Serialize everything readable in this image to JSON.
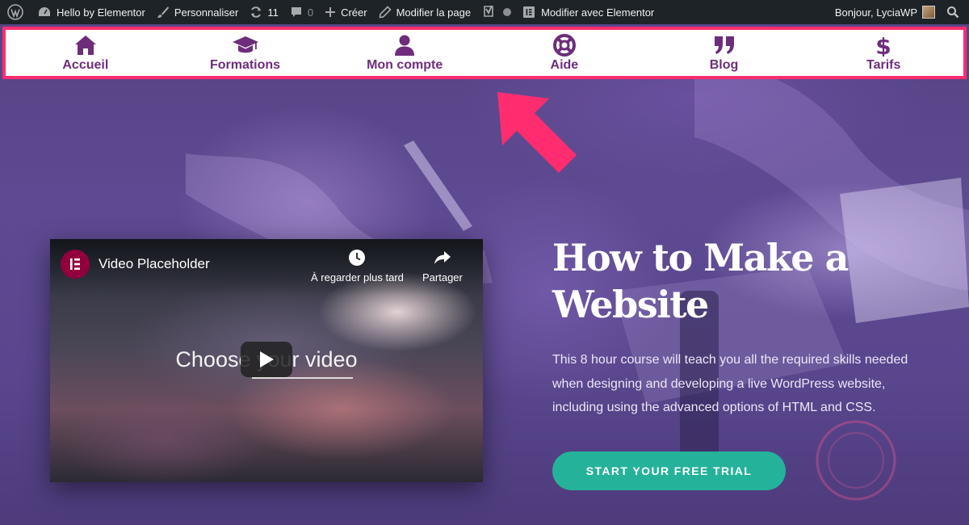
{
  "admin_bar": {
    "site_name": "Hello by Elementor",
    "customize": "Personnaliser",
    "updates_count": "11",
    "comments_count": "0",
    "new_label": "Créer",
    "edit_page": "Modifier la page",
    "edit_with_elementor": "Modifier avec Elementor",
    "greeting": "Bonjour, LyciaWP"
  },
  "nav": {
    "items": [
      {
        "label": "Accueil",
        "icon": "home-icon"
      },
      {
        "label": "Formations",
        "icon": "graduation-cap-icon"
      },
      {
        "label": "Mon compte",
        "icon": "user-icon"
      },
      {
        "label": "Aide",
        "icon": "life-ring-icon"
      },
      {
        "label": "Blog",
        "icon": "quote-icon"
      },
      {
        "label": "Tarifs",
        "icon": "dollar-icon"
      }
    ],
    "color": "#6d2d7a",
    "highlight_border": "#ff2d6f"
  },
  "video": {
    "title": "Video Placeholder",
    "watch_later": "À regarder plus tard",
    "share": "Partager",
    "center_text": "Choose your video"
  },
  "hero": {
    "title": "How to Make a Website",
    "description": "This 8 hour course will teach you all the required skills needed when designing and developing a live WordPress website, including using the advanced options of HTML and CSS.",
    "cta": "START YOUR FREE TRIAL",
    "cta_color": "#25b29b",
    "arrow_color": "#ff2d6f"
  }
}
